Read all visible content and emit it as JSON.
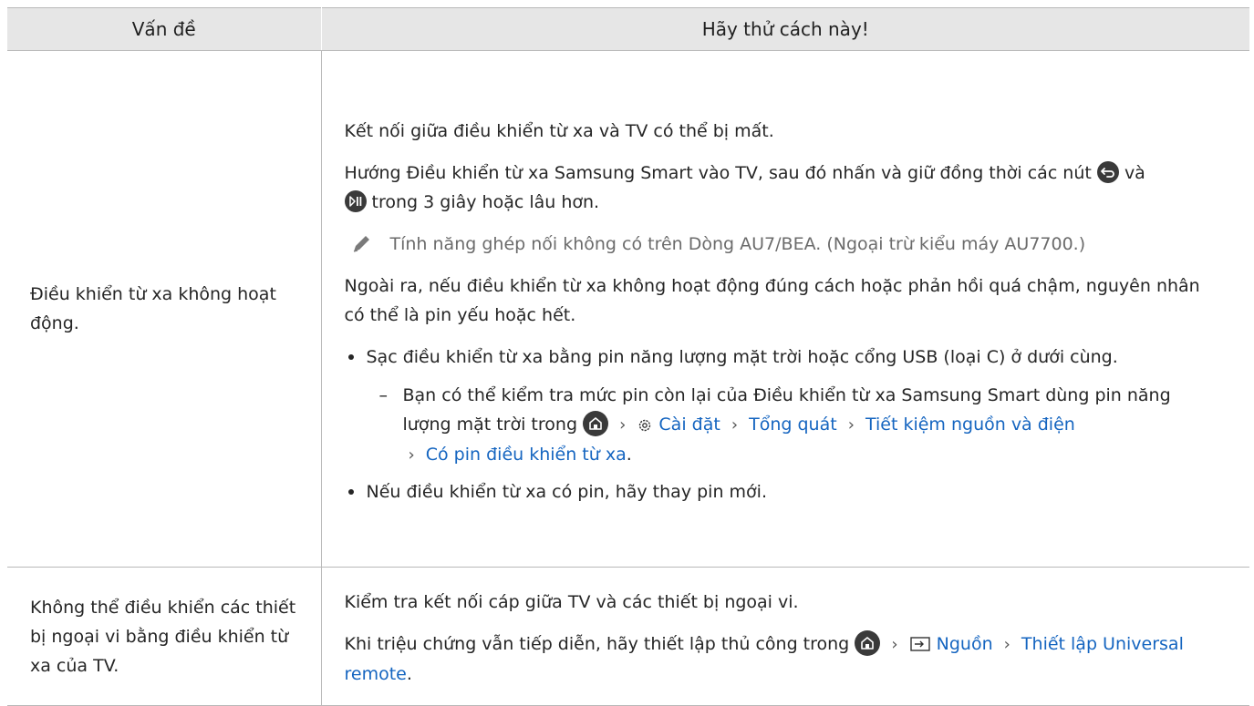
{
  "header": {
    "col1": "Vấn đề",
    "col2": "Hãy thử cách này!"
  },
  "rows": [
    {
      "problem": "Điều khiển từ xa không hoạt động.",
      "p1": "Kết nối giữa điều khiển từ xa và TV có thể bị mất.",
      "p2_a": "Hướng Điều khiển từ xa Samsung Smart vào TV, sau đó nhấn và giữ đồng thời các nút",
      "p2_b": "và",
      "p2_c": "trong 3 giây hoặc lâu hơn.",
      "note": "Tính năng ghép nối không có trên Dòng AU7/BEA. (Ngoại trừ kiểu máy AU7700.)",
      "p3": "Ngoài ra, nếu điều khiển từ xa không hoạt động đúng cách hoặc phản hồi quá chậm, nguyên nhân có thể là pin yếu hoặc hết.",
      "bullet1": "Sạc điều khiển từ xa bằng pin năng lượng mặt trời hoặc cổng USB (loại C) ở dưới cùng.",
      "sub_dash": "–",
      "sub_text": "Bạn có thể kiểm tra mức pin còn lại của Điều khiển từ xa Samsung Smart dùng pin năng lượng mặt trời trong",
      "menu_settings": "Cài đặt",
      "menu_general": "Tổng quát",
      "menu_power": "Tiết kiệm nguồn và điện",
      "menu_battery": "Có pin điều khiển từ xa",
      "bullet2": "Nếu điều khiển từ xa có pin, hãy thay pin mới."
    },
    {
      "problem": "Không thể điều khiển các thiết bị ngoại vi bằng điều khiển từ xa của TV.",
      "p1": "Kiểm tra kết nối cáp giữa TV và các thiết bị ngoại vi.",
      "p2": "Khi triệu chứng vẫn tiếp diễn, hãy thiết lập thủ công trong",
      "menu_source": "Nguồn",
      "menu_universal": "Thiết lập Universal remote"
    }
  ],
  "punct": {
    "period": "."
  },
  "icons": {
    "return": "return-button-icon",
    "play_pause": "play-pause-button-icon",
    "home": "home-icon",
    "settings": "gear-icon",
    "source": "source-icon",
    "note": "pencil-note-icon",
    "chevron": "›"
  },
  "colors": {
    "header_bg": "#e6e6e6",
    "link": "#1565c0",
    "note_text": "#6b6b6b",
    "border": "#b9b9b9"
  }
}
